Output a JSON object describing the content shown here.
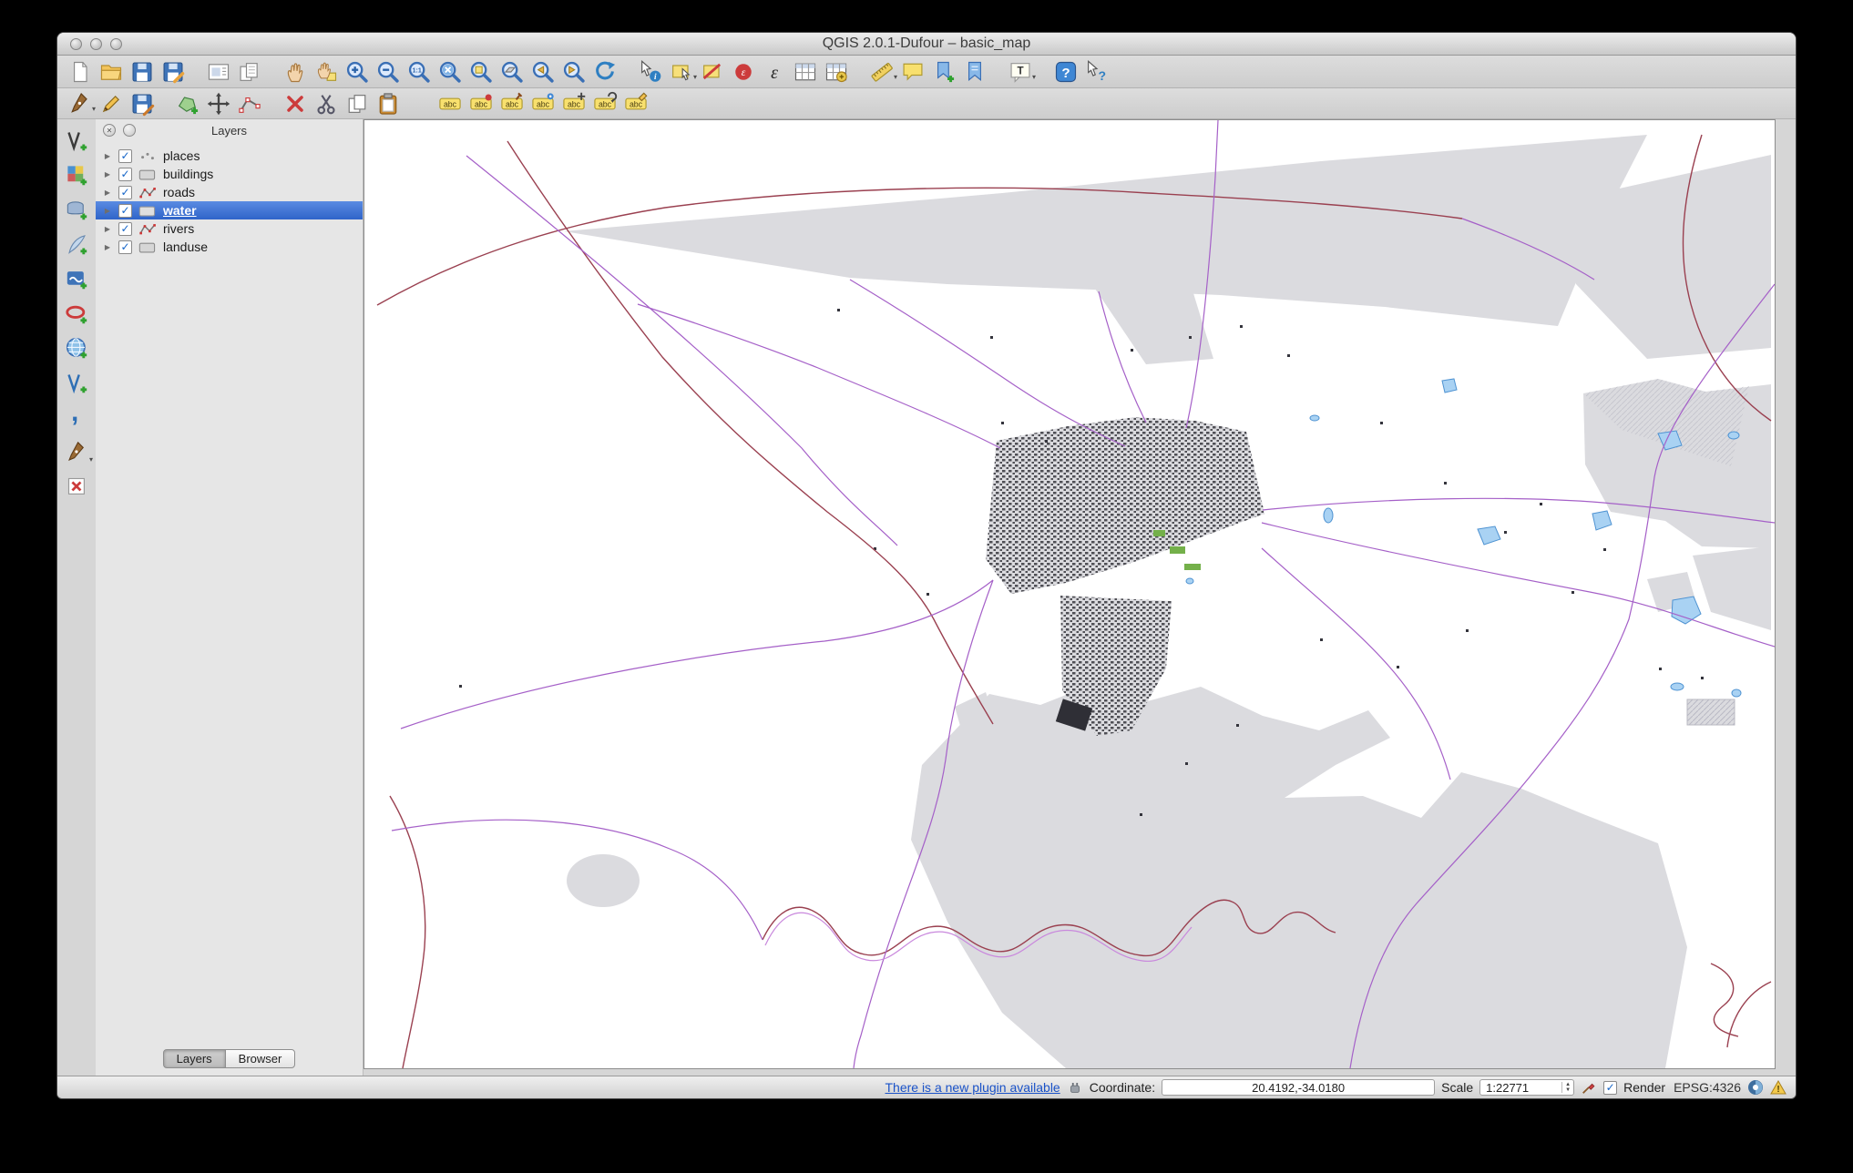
{
  "window": {
    "title": "QGIS 2.0.1-Dufour – basic_map"
  },
  "toolbars": {
    "row1": [
      "new-project",
      "open-project",
      "save-project",
      "save-project-as",
      "new-print-composer",
      "composer-manager",
      "pan-map",
      "pan-to-selection",
      "zoom-in",
      "zoom-out",
      "zoom-native",
      "zoom-full",
      "zoom-to-selection",
      "zoom-to-layer",
      "zoom-last",
      "zoom-next",
      "refresh-map",
      "identify-features",
      "select-features",
      "deselect-features",
      "select-by-expression",
      "epsilon-expression",
      "open-attribute-table",
      "field-calculator",
      "measure",
      "map-tips",
      "new-bookmark",
      "show-bookmarks",
      "text-annotation",
      "help-contents",
      "whats-this"
    ],
    "row2": [
      "current-edits",
      "toggle-editing",
      "save-layer-edits",
      "add-feature",
      "move-feature",
      "node-tool",
      "delete-selected",
      "cut-features",
      "copy-features",
      "paste-features",
      "labeling-options",
      "label-highlight-pinned",
      "label-pin",
      "label-show-hide",
      "label-move",
      "label-rotate",
      "label-properties"
    ],
    "left": [
      "add-vector-layer",
      "add-raster-layer",
      "add-postgis-layer",
      "add-spatialite-layer",
      "add-mssql-layer",
      "add-oracle-layer",
      "add-wms-layer",
      "add-wfs-layer",
      "add-delimited-text-layer",
      "new-shapefile-layer",
      "remove-layer"
    ]
  },
  "layers_panel": {
    "title": "Layers",
    "layers": [
      {
        "label": "places",
        "checked": true,
        "selected": false,
        "type": "point"
      },
      {
        "label": "buildings",
        "checked": true,
        "selected": false,
        "type": "polygon"
      },
      {
        "label": "roads",
        "checked": true,
        "selected": false,
        "type": "line"
      },
      {
        "label": "water",
        "checked": true,
        "selected": true,
        "type": "polygon"
      },
      {
        "label": "rivers",
        "checked": true,
        "selected": false,
        "type": "line"
      },
      {
        "label": "landuse",
        "checked": true,
        "selected": false,
        "type": "polygon"
      }
    ],
    "tabs": [
      {
        "label": "Layers",
        "active": true
      },
      {
        "label": "Browser",
        "active": false
      }
    ]
  },
  "status_bar": {
    "plugin_link": "There is a new plugin available",
    "coordinate_label": "Coordinate:",
    "coordinate_value": "20.4192,-34.0180",
    "scale_label": "Scale",
    "scale_value": "1:22771",
    "render_label": "Render",
    "epsg_label": "EPSG:4326"
  },
  "map": {
    "colors": {
      "landuse_fill": "#dbdbdf",
      "roads_stroke": "#a560c8",
      "rivers_stroke": "#9a4050",
      "water_fill": "#a9d2f3",
      "buildings_fill": "#3f3f46",
      "selection_blue": "#2f64c9"
    }
  }
}
